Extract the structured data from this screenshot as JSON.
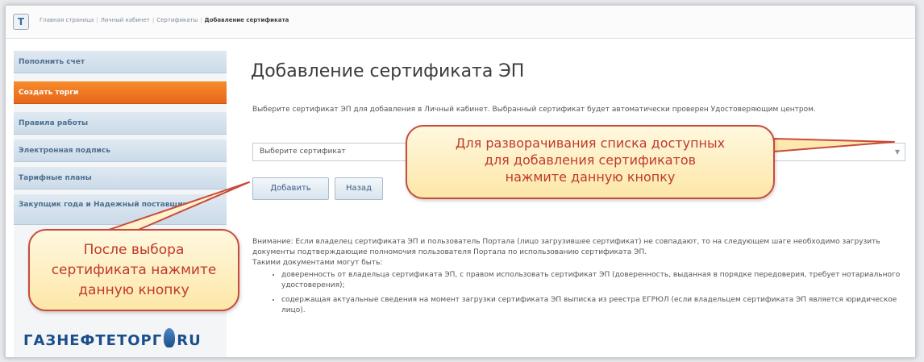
{
  "breadcrumb": {
    "home_icon": "Т",
    "items": [
      "Главная страница",
      "Личный кабинет",
      "Сертификаты"
    ],
    "current": "Добавление сертификата"
  },
  "sidebar": {
    "items": [
      {
        "label": "Пополнить счет",
        "active": false
      },
      {
        "label": "Создать торги",
        "active": true
      },
      {
        "label": "Правила работы",
        "active": false
      },
      {
        "label": "Электронная подпись",
        "active": false
      },
      {
        "label": "Тарифные планы",
        "active": false
      },
      {
        "label": "Закупщик года и Надежный поставщик",
        "active": false
      }
    ],
    "logo": {
      "left": "ГАЗНЕФТЕТОРГ",
      "right": "RU"
    }
  },
  "main": {
    "title": "Добавление сертификата ЭП",
    "intro": "Выберите сертификат ЭП для добавления в Личный кабинет. Выбранный сертификат будет автоматически проверен Удостоверяющим центром.",
    "select": {
      "value": "Выберите сертификат",
      "arrow": "▼"
    },
    "add_button": "Добавить",
    "back_button": "Назад",
    "warning": "Внимание: Если владелец сертификата ЭП и пользователь Портала (лицо загрузившее сертификат) не совпадают, то на следующем шаге необходимо загрузить документы подтверждающие полномочия пользователя Портала по использованию сертификата ЭП.",
    "docs_heading": "Такими документами могут быть:",
    "docs": [
      "доверенность от владельца сертификата ЭП, с правом использовать сертификат ЭП (доверенность, выданная в порядке передоверия, требует нотариального удостоверения);",
      "содержащая актуальные сведения на момент загрузки сертификата ЭП выписка из реестра ЕГРЮЛ (если владельцем сертификата ЭП является юридическое лицо)."
    ]
  },
  "callouts": {
    "select_hint": [
      "Для разворачивания списка доступных",
      "для добавления сертификатов",
      "нажмите данную кнопку"
    ],
    "add_hint": [
      "После выбора",
      "сертификата нажмите",
      "данную кнопку"
    ]
  },
  "colors": {
    "accent": "#e9661a",
    "nav": "#cbdbe8",
    "callout_border": "#c84b3b",
    "callout_text": "#c0392b"
  }
}
